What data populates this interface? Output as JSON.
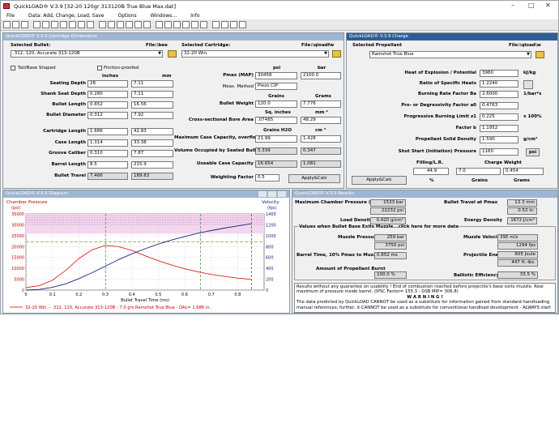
{
  "window": {
    "title": "QuickLOAD® V.3.9   [32-20 120gr 313120B True Blue Max.dat]"
  },
  "menu": [
    "File",
    "Data: Add, Change, Load, Save",
    "Options",
    "Windows...",
    "Info"
  ],
  "cartridge": {
    "title": "QuickLOAD® V.3.9 Cartridge Dimensions",
    "selected_bullet_label": "Selected Bullet:",
    "bullet_file_label": "File:\\bee",
    "bullet_value": ".312, 120, Accurate 313-120B",
    "selected_cartridge_label": "Selected Cartridge:",
    "cartridge_file_label": "File:\\qloadfw",
    "cartridge_value": "32-20 Win.",
    "tail_label": "Tail/Base Shaped",
    "friction_label": "Friction-proofed",
    "units_inches": "inches",
    "units_mm": "mm",
    "rows": [
      {
        "label": "Seating Depth",
        "in": "28",
        "mm": "7.11"
      },
      {
        "label": "Shank Seat Depth",
        "in": "0.280",
        "mm": "7.11"
      },
      {
        "label": "Bullet Length",
        "in": "0.652",
        "mm": "16.56"
      },
      {
        "label": "Bullet Diameter",
        "in": "0.312",
        "mm": "7.92"
      },
      {
        "label": "Cartridge Length",
        "in": "1.686",
        "mm": "42.83"
      },
      {
        "label": "Case Length",
        "in": "1.314",
        "mm": "33.38"
      },
      {
        "label": "Groove Caliber",
        "in": "0.310",
        "mm": "7.87"
      },
      {
        "label": "Barrel Length",
        "in": "8.5",
        "mm": "215.9"
      },
      {
        "label": "Bullet Travel",
        "in": "7.466",
        "mm": "189.63"
      }
    ],
    "psi_label": "psi",
    "bar_label": "bar",
    "pmax_label": "Pmax (MAP)",
    "pmax_psi": "30458",
    "pmax_bar": "2100.0",
    "meas_method_label": "Meas. Method",
    "meas_method_value": "Piezo CIP",
    "grains_label": "Grains",
    "grams_label": "Grams",
    "bullet_weight_label": "Bullet Weight",
    "bullet_weight_gr": "120.0",
    "bullet_weight_g": "7.776",
    "sq_in_label": "Sq. inches",
    "mm2_label": "mm ²",
    "bore_area_label": "Cross-sectional Bore Area",
    "bore_area_in": ".07485",
    "bore_area_mm": "48.29",
    "grains_h2o_label": "Grains H2O",
    "cm3_label": "cm ³",
    "max_cap_label": "Maximum Case Capacity, overflow",
    "max_cap_gr": "21.99",
    "max_cap_cm": "1.428",
    "vol_seated_label": "Volume Occupied by Seated Bullet",
    "vol_seated_gr": "5.339",
    "vol_seated_cm": "0.347",
    "usable_cap_label": "Useable Case Capacity",
    "usable_cap_gr": "16.654",
    "usable_cap_cm": "1.081",
    "weighting_label": "Weighting Factor",
    "weighting_value": "0.5",
    "apply_button": "Apply&Calc"
  },
  "charge": {
    "title": "QuickLOAD® V.3.9 Charge",
    "selected_propellant_label": "Selected Propellant",
    "file_label": "File:\\qload\\w",
    "propellant_value": "Ramshot True Blue",
    "rows": [
      {
        "label": "Heat of Explosion / Potential",
        "value": "3980",
        "unit": "kJ/kg"
      },
      {
        "label": "Ratio of Specific Heats",
        "value": "1.2240",
        "unit": ""
      },
      {
        "label": "Burning Rate Factor  Ba",
        "value": "2.6000",
        "unit": "1/bar*s"
      },
      {
        "label": "Pro- or Degressivity Factor  a0",
        "value": "0.4763",
        "unit": ""
      },
      {
        "label": "Progressive Burning Limit z1",
        "value": "0.225",
        "unit": "x 100%"
      },
      {
        "label": "Factor  b",
        "value": "1.1952",
        "unit": ""
      },
      {
        "label": "Propellant Solid Density",
        "value": "1.590",
        "unit": "g/cm³"
      },
      {
        "label": "Shot Start (Initiation) Pressure",
        "value": "1160",
        "unit": "psi"
      }
    ],
    "filling_label": "Filling/L.R.",
    "charge_weight_label": "Charge Weight",
    "filling_value": "44.9",
    "charge_gr": "7.0",
    "charge_g": "0.454",
    "pct_label": "%",
    "grains_label": "Grains",
    "grams_label": "Grams",
    "apply_button": "Apply&Calc"
  },
  "diagram": {
    "title": "QuickLOAD® V.3.9 Diagram",
    "y_left_label": "Chamber Pressure",
    "y_left_unit": "(psi)",
    "y_right_label": "Velocity",
    "y_right_unit": "(fps)",
    "x_label": "Bullet Travel Time (ms)",
    "legend": "32-20 Win. - .312, 120, Accurate 313-120B - 7.0 grs Ramshot True Blue - OAL= 1.686 in."
  },
  "chart_data": {
    "type": "line",
    "xlabel": "Bullet Travel Time (ms)",
    "ylabel": "Chamber Pressure (psi)",
    "y2label": "Velocity (fps)",
    "xlim": [
      0,
      0.9
    ],
    "ylim": [
      0,
      35000
    ],
    "y2lim": [
      0,
      1400
    ],
    "x_ticks": [
      "0",
      "0.1",
      "0.2",
      "0.3",
      "0.4",
      "0.5",
      "0.6",
      "0.7",
      "0.8"
    ],
    "y_ticks": [
      "0",
      "5000",
      "10000",
      "15000",
      "20000",
      "25000",
      "30000",
      "35000"
    ],
    "y2_ticks": [
      "0",
      "200",
      "400",
      "600",
      "800",
      "1000",
      "1200",
      "1400"
    ],
    "series": [
      {
        "name": "Chamber Pressure",
        "color": "#e02020",
        "axis": "left",
        "x": [
          0,
          0.05,
          0.1,
          0.15,
          0.2,
          0.25,
          0.3,
          0.35,
          0.4,
          0.45,
          0.5,
          0.55,
          0.6,
          0.65,
          0.7,
          0.75,
          0.8,
          0.852
        ],
        "y": [
          1160,
          2000,
          4500,
          9000,
          14500,
          18500,
          20500,
          20000,
          18200,
          15800,
          13500,
          11500,
          9800,
          8400,
          7200,
          6300,
          5500,
          4900
        ]
      },
      {
        "name": "Velocity",
        "color": "#1a237e",
        "axis": "right",
        "x": [
          0,
          0.05,
          0.1,
          0.15,
          0.2,
          0.25,
          0.3,
          0.35,
          0.4,
          0.45,
          0.5,
          0.55,
          0.6,
          0.65,
          0.7,
          0.75,
          0.8,
          0.852
        ],
        "y": [
          0,
          12,
          50,
          115,
          210,
          320,
          440,
          560,
          665,
          760,
          845,
          920,
          985,
          1045,
          1095,
          1140,
          1180,
          1220
        ]
      }
    ]
  },
  "results": {
    "title": "QuickLOAD® V.3.9 Results",
    "max_pressure_label": "Maximum Chamber Pressure (Pmax)",
    "max_pressure_bar": "1533 bar",
    "max_pressure_psi": "22232 psi",
    "travel_at_pmax_label": "Bullet Travel at Pmax",
    "travel_mm": "13.3 mm",
    "travel_in": "0.52 in.",
    "load_density_label": "Load Density",
    "load_density_value": "0.420 g/cm³",
    "energy_density_label": "Energy Density",
    "energy_density_value": "1672 J/cm³",
    "muzzle_section_label": "Values when Bullet Base Exits Muzzle...click here for more data",
    "muzzle_pressure_label": "Muzzle Pressure",
    "muzzle_pressure_bar": "259 bar",
    "muzzle_pressure_psi": "3750 psi",
    "muzzle_velocity_label": "Muzzle Velocity",
    "muzzle_velocity_ms": "395 m/s",
    "muzzle_velocity_fps": "1294 fps",
    "barrel_time_label": "Barrel Time, 10% Pmax to Muzzle",
    "barrel_time_value": "0.852 ms",
    "energy_label": "Projectile Energy",
    "energy_joule": "605 Joule",
    "energy_ftlbs": "447 ft.-lbs.",
    "burnt_label": "Amount of Propellant Burnt",
    "burnt_value": "100.0 %",
    "efficiency_label": "Ballistic Efficiency",
    "efficiency_value": "33.5 %",
    "warning_lines": [
      "Results without any guarantee on usability !  End of combustion reached before projectile's base exits muzzle.  Real",
      "maximum of pressure inside barrel.  (IPSC Factor= 155.3 - DSB MIP= 306.8)",
      "W A R N I N G !",
      "The data predicted by QuickLOAD CANNOT be used as a substitute for information gained from standard handloading",
      "manual references; further, it CANNOT be used as a substitute for conventional handload development - ALWAYS start"
    ]
  }
}
